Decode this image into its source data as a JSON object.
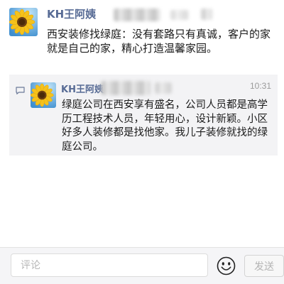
{
  "post": {
    "author": "KH王阿姨",
    "avatar_icon": "sunflower-avatar",
    "text": "西安装修找绿庭：没有套路只有真诚，客户的家就是自己的家，精心打造温馨家园。"
  },
  "comment": {
    "indicator_icon": "comment-bubble-icon",
    "author": "KH王阿姨",
    "avatar_icon": "sunflower-avatar",
    "time": "10:31",
    "text": "绿庭公司在西安享有盛名，公司人员都是高学历工程技术人员，年轻用心，设计新颖。小区好多人装修都是找他家。我儿子装修就找的绿庭公司。"
  },
  "input_bar": {
    "placeholder": "评论",
    "emoji_icon": "emoji-icon",
    "send_label": "发送"
  },
  "colors": {
    "author_name": "#576b95",
    "comment_background": "#f3f3f5",
    "send_disabled_text": "#b4b4b4"
  }
}
